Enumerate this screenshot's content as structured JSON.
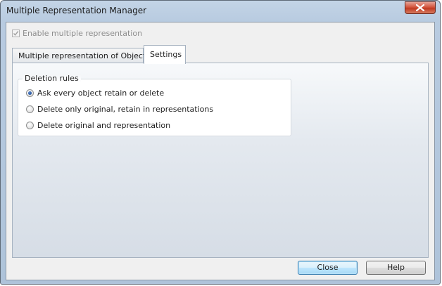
{
  "window": {
    "title": "Multiple Representation Manager"
  },
  "enable_checkbox": {
    "label": "Enable multiple representation",
    "checked": true,
    "disabled": true
  },
  "tabs": [
    {
      "label": "Multiple representation of Objects",
      "active": false
    },
    {
      "label": "Settings",
      "active": true
    }
  ],
  "deletion_rules": {
    "title": "Deletion rules",
    "options": [
      {
        "label": "Ask every object retain or delete",
        "selected": true
      },
      {
        "label": "Delete only original, retain in representations",
        "selected": false
      },
      {
        "label": "Delete original and representation",
        "selected": false
      }
    ]
  },
  "buttons": {
    "close": "Close",
    "help": "Help"
  }
}
